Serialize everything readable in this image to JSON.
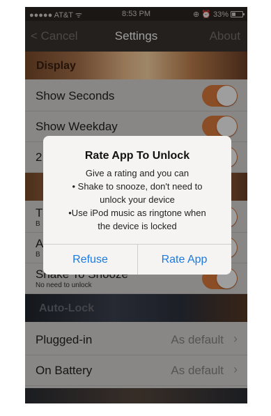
{
  "status_bar": {
    "carrier": "●●●●● AT&T ᯤ",
    "time": "8:53 PM",
    "battery": "33%"
  },
  "nav": {
    "back": "< Cancel",
    "title": "Settings",
    "right": "About"
  },
  "sections": {
    "display": {
      "header": "Display",
      "rows": [
        "Show Seconds",
        "Show Weekday",
        "2"
      ]
    },
    "middle": {
      "rows": [
        {
          "label": "T",
          "sub": "B"
        },
        {
          "label": "A",
          "sub": "B"
        },
        {
          "label": "Shake To Snooze",
          "sub": "No need to unlock"
        }
      ]
    },
    "autolock": {
      "header": "Auto-Lock",
      "rows": [
        {
          "label": "Plugged-in",
          "value": "As default"
        },
        {
          "label": "On Battery",
          "value": "As default"
        }
      ]
    }
  },
  "alert": {
    "title": "Rate App To Unlock",
    "lines": [
      "Give a rating and you can",
      "• Shake to snooze, don't need to",
      "unlock your device",
      "•Use iPod music as ringtone when",
      "the device is locked"
    ],
    "refuse": "Refuse",
    "rate": "Rate App"
  },
  "colors": {
    "accent_toggle": "#e07d3e",
    "alert_button": "#1a7ae0"
  }
}
